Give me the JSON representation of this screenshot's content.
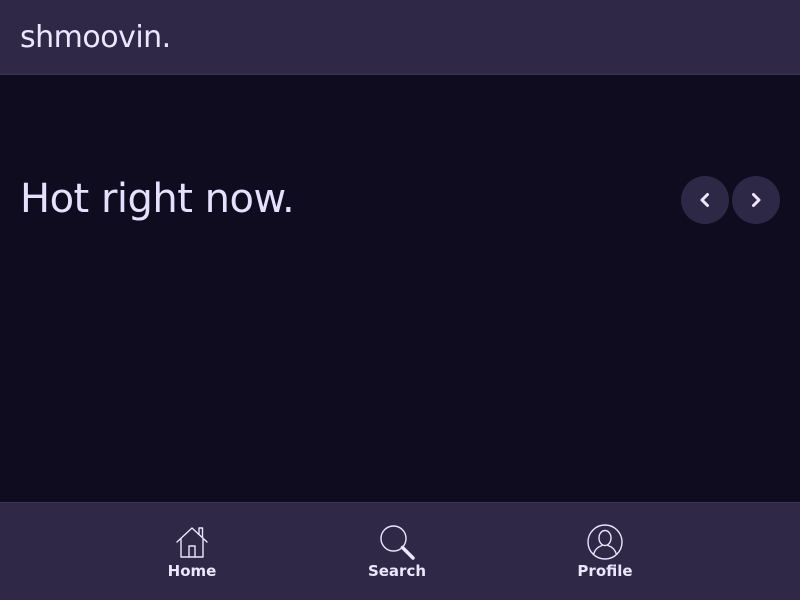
{
  "app": {
    "brand": "shmoovin."
  },
  "main": {
    "section_title": "Hot right now."
  },
  "carousel": {
    "prev_icon": "chevron-left-icon",
    "next_icon": "chevron-right-icon"
  },
  "nav": {
    "items": [
      {
        "label": "Home",
        "icon": "home-icon"
      },
      {
        "label": "Search",
        "icon": "search-icon"
      },
      {
        "label": "Profile",
        "icon": "profile-icon"
      }
    ]
  },
  "colors": {
    "bar_bg": "#2f2847",
    "main_bg": "#0f0c1f",
    "text": "#ece6ff",
    "button_bg": "#2d2845"
  }
}
